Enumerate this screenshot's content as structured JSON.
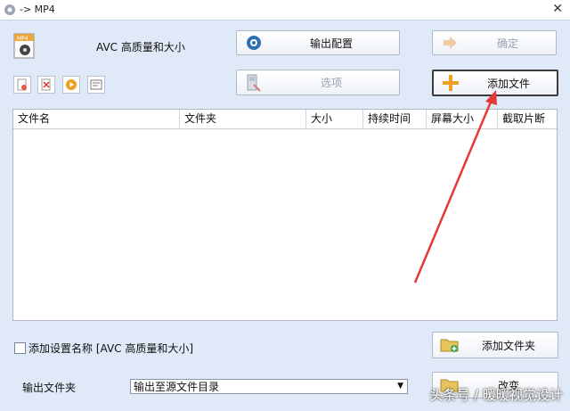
{
  "window": {
    "title": "-> MP4",
    "close_glyph": "✕"
  },
  "profile": {
    "icon": "mp4-file-icon",
    "label": "AVC 高质量和大小"
  },
  "buttons": {
    "output_config": "输出配置",
    "ok": "确定",
    "options": "选项",
    "add_file": "添加文件",
    "add_folder": "添加文件夹",
    "change": "改变"
  },
  "table": {
    "columns": [
      "文件名",
      "文件夹",
      "大小",
      "持续时间",
      "屏幕大小",
      "截取片断"
    ],
    "rows": []
  },
  "save_setting": {
    "label": "添加设置名称 [AVC 高质量和大小]",
    "checked": false
  },
  "output_folder": {
    "label": "输出文件夹",
    "value": "输出至源文件目录"
  },
  "watermark": "头条号 / 暖暖视觉设计",
  "colors": {
    "accent_plus": "#f0a020",
    "arrow": "#e53935"
  }
}
